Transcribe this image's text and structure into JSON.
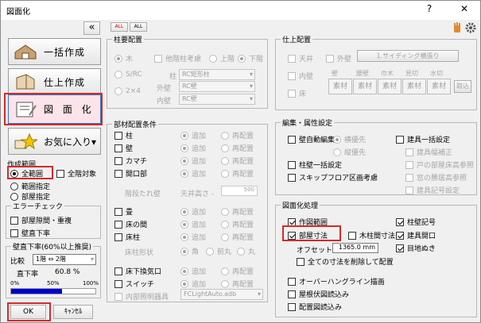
{
  "window": {
    "title": "図面化",
    "help": "?",
    "close": "✕"
  },
  "left": {
    "collapse": "«",
    "buttons": [
      {
        "label": "一括作成"
      },
      {
        "label": "仕上作成"
      },
      {
        "label": "図 面 化"
      },
      {
        "label": "お気に入り▾"
      }
    ],
    "range": {
      "title": "作成範囲",
      "all": "全範囲",
      "all_floors": "全階対象",
      "area": "範囲指定",
      "room": "部屋指定"
    },
    "error": {
      "title": "エラーチェック",
      "overlap": "部屋隙間・重複",
      "drop": "壁直下率"
    },
    "ratio": {
      "title": "壁直下率(60%以上推奨)",
      "compare": "比較",
      "floors": "1階 ⇔ 2階",
      "rate_label": "直下率",
      "rate_value": "60.8 %",
      "p0": "0%",
      "p50": "50%",
      "p100": "100%",
      "fill": 0.608
    },
    "ok": "OK",
    "cancel": "ｷｬﾝｾﾙ"
  },
  "top_icons": {
    "all_on": "ALL",
    "all_off": "ALL"
  },
  "pillar": {
    "title": "柱要配置",
    "wood": "木",
    "other_consider": "他階柱考慮",
    "upper": "上階",
    "lower": "下階",
    "src": "S/RC",
    "col": "柱",
    "col_val": "RC矩形柱",
    "two4": "2×4",
    "outer": "外壁",
    "outer_val": "RC壁",
    "inner": "内壁",
    "inner_val": "RC壁"
  },
  "member": {
    "title": "部材配置条件",
    "rows": [
      {
        "label": "柱",
        "add": "追加",
        "re": "再配置"
      },
      {
        "label": "壁",
        "add": "追加",
        "re": "再配置"
      },
      {
        "label": "カマチ",
        "add": "追加",
        "re": "再配置"
      },
      {
        "label": "開口部",
        "add": "追加",
        "re": "再配置"
      }
    ],
    "hari": "階段たれ壁",
    "tenjo": "天井高さ -",
    "tenjo_val": "500",
    "rows2": [
      {
        "label": "畳",
        "add": "追加",
        "re": "再配置"
      },
      {
        "label": "床の間",
        "add": "追加",
        "re": "再配置"
      },
      {
        "label": "床柱",
        "add": "追加",
        "re": "再配置"
      }
    ],
    "tokobashira": "床柱形状",
    "kaku": "角",
    "maemaru": "前丸",
    "maru": "丸",
    "rows3": [
      {
        "label": "床下換気口",
        "add": "追加",
        "re": "再配置"
      },
      {
        "label": "スイッチ",
        "add": "追加",
        "re": "再配置"
      }
    ],
    "lighting": "内部照明器具",
    "lighting_val": "FCLightAuto.adb"
  },
  "finish": {
    "title": "仕上配置",
    "roof": "天井",
    "outer": "外壁",
    "outer_btn": "1.サイディング横張り",
    "inner": "内壁",
    "floor": "床",
    "cols": [
      "壁",
      "腰壁",
      "巾木",
      "見切",
      "水切"
    ],
    "sozai": "素材",
    "remove": "取込"
  },
  "edit": {
    "title": "編集・属性設定",
    "wall_auto": "壁自動編集",
    "horiz": "横優先",
    "vert": "縦優先",
    "tategu": "建具一括設定",
    "tategu_w": "建具幅補正",
    "toda": "戸の部屋床高参照",
    "madou": "窓の勝居高参照",
    "tategu_no": "建具記号設定",
    "pillar_set": "柱壁一括設定",
    "skip": "スキップフロア区画考慮"
  },
  "draw": {
    "title": "図面化処理",
    "range": "作図範囲",
    "room_dim": "部屋寸法",
    "wood_dim": "木柱間寸法",
    "offset": "オフセット",
    "offset_val": "1365.0 mm",
    "reset": "全ての寸法を削除して配置",
    "overhang": "オーバーハングライン描画",
    "yane": "屋根伏図読込み",
    "haichi": "配置図読込み",
    "pillar_sym": "柱壁記号",
    "opening": "建具開口",
    "eaves": "目地ぬき"
  }
}
